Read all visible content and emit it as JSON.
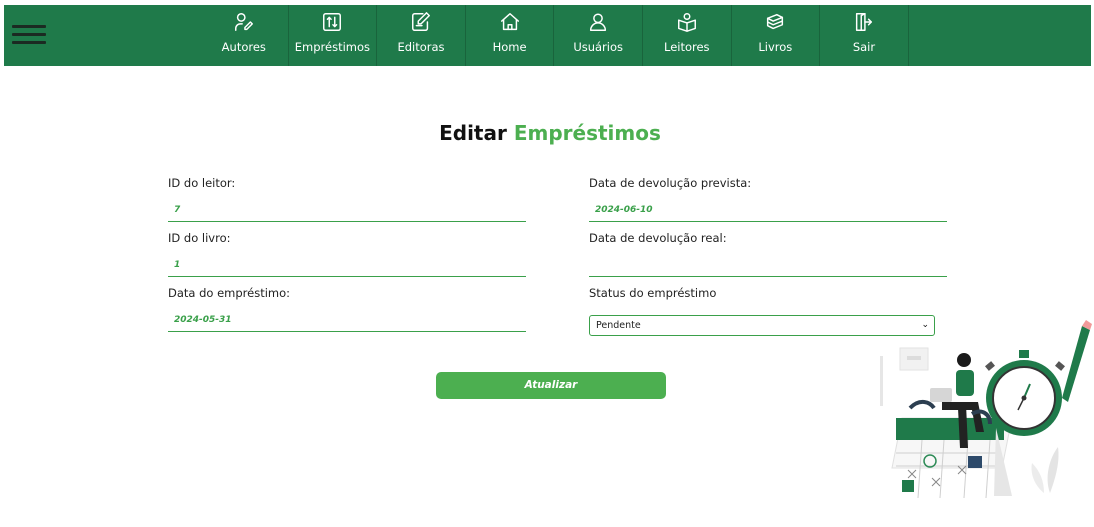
{
  "nav": {
    "items": [
      {
        "label": "Autores",
        "icon": "authors-icon"
      },
      {
        "label": "Empréstimos",
        "icon": "loans-icon"
      },
      {
        "label": "Editoras",
        "icon": "publishers-icon"
      },
      {
        "label": "Home",
        "icon": "home-icon"
      },
      {
        "label": "Usuários",
        "icon": "user-icon"
      },
      {
        "label": "Leitores",
        "icon": "readers-icon"
      },
      {
        "label": "Livros",
        "icon": "books-icon"
      },
      {
        "label": "Sair",
        "icon": "logout-icon"
      }
    ]
  },
  "page": {
    "title_main": "Editar",
    "title_accent": "Empréstimos"
  },
  "form": {
    "reader_id": {
      "label": "ID do leitor:",
      "value": "7"
    },
    "book_id": {
      "label": "ID do livro:",
      "value": "1"
    },
    "loan_date": {
      "label": "Data do empréstimo:",
      "value": "2024-05-31"
    },
    "expected_return": {
      "label": "Data de devolução prevista:",
      "value": "2024-06-10"
    },
    "actual_return": {
      "label": "Data de devolução real:",
      "value": ""
    },
    "status": {
      "label": "Status do empréstimo",
      "value": "Pendente"
    },
    "submit_label": "Atualizar"
  },
  "colors": {
    "navbar": "#1f7a4a",
    "accent": "#4caf50"
  }
}
